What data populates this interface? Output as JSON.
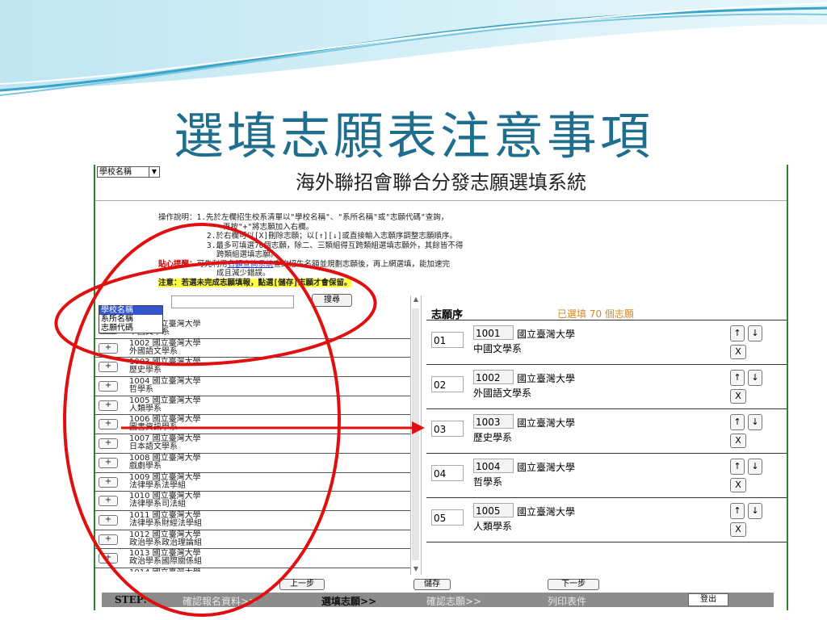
{
  "slide": {
    "title": "選填志願表注意事項"
  },
  "system": {
    "title": "海外聯招會聯合分發志願選填系統"
  },
  "instructions": {
    "lines": [
      "操作說明：1.先於左欄招生校系清單以\"學校名稱\"、\"系所名稱\"或\"志願代碼\"查詢，",
      "再按\"+\"將志願加入右欄。",
      "2.於右欄可以[X]刪除志願；以[↑][↓]或直接輸入志願序調整志願順序。",
      "3.最多可填選70個志願，除二、三類組得互跨類組選填志願外，其餘皆不得",
      "跨類組選填志願。"
    ],
    "tip_label": "貼心提醒：",
    "tip_pre": "可先利用",
    "tip_link": "名額查詢系統",
    "tip_post": "查詢招生名額並規劃志願後，再上網選填，能加速完",
    "tip_line2": "成且減少錯誤。",
    "note": "注意：若選未完成志願填報，點選[儲存]志願才會保留。"
  },
  "search": {
    "type_selected": "學校名稱",
    "type_options": [
      "學校名稱",
      "系所名稱",
      "志願代碼"
    ],
    "button": "搜尋",
    "list_header": "清單"
  },
  "school_list": [
    {
      "l1": "1001 國立臺灣大學",
      "l2": "中國文學系"
    },
    {
      "l1": "1002 國立臺灣大學",
      "l2": "外國語文學系"
    },
    {
      "l1": "1003 國立臺灣大學",
      "l2": "歷史學系"
    },
    {
      "l1": "1004 國立臺灣大學",
      "l2": "哲學系"
    },
    {
      "l1": "1005 國立臺灣大學",
      "l2": "人類學系"
    },
    {
      "l1": "1006 國立臺灣大學",
      "l2": "圖書資訊學系"
    },
    {
      "l1": "1007 國立臺灣大學",
      "l2": "日本語文學系"
    },
    {
      "l1": "1008 國立臺灣大學",
      "l2": "戲劇學系"
    },
    {
      "l1": "1009 國立臺灣大學",
      "l2": "法律學系法學組"
    },
    {
      "l1": "1010 國立臺灣大學",
      "l2": "法律學系司法組"
    },
    {
      "l1": "1011 國立臺灣大學",
      "l2": "法律學系財經法學組"
    },
    {
      "l1": "1012 國立臺灣大學",
      "l2": "政治學系政治理論組"
    },
    {
      "l1": "1013 國立臺灣大學",
      "l2": "政治學系國際關係組"
    },
    {
      "l1": "1014 國立臺灣大學",
      "l2": ""
    }
  ],
  "plus_label": "+",
  "wish_panel": {
    "header": "志願序",
    "count_text": "已選填 70 個志願",
    "rows": [
      {
        "order": "01",
        "code": "1001",
        "uni": "國立臺灣大學",
        "dept": "中國文學系"
      },
      {
        "order": "02",
        "code": "1002",
        "uni": "國立臺灣大學",
        "dept": "外國語文學系"
      },
      {
        "order": "03",
        "code": "1003",
        "uni": "國立臺灣大學",
        "dept": "歷史學系"
      },
      {
        "order": "04",
        "code": "1004",
        "uni": "國立臺灣大學",
        "dept": "哲學系"
      },
      {
        "order": "05",
        "code": "1005",
        "uni": "國立臺灣大學",
        "dept": "人類學系"
      }
    ],
    "up_label": "↑",
    "down_label": "↓",
    "delete_label": "X"
  },
  "nav": {
    "prev": "上一步",
    "save": "儲存",
    "next": "下一步"
  },
  "steps": {
    "label": "STEP:",
    "items": [
      "確認報名資料>>",
      "選填志願>>",
      "確認志願>>",
      "列印表件"
    ],
    "logout": "登出"
  },
  "colors": {
    "title": "#1f6e8e",
    "annotation": "#e01010",
    "border_green": "#2e7d32",
    "count_orange": "#d08a2a"
  }
}
